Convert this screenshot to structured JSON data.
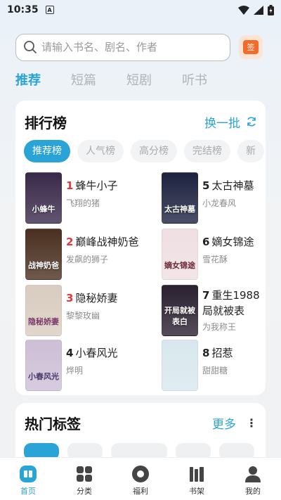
{
  "status": {
    "time": "10:35",
    "a_badge": "A"
  },
  "search": {
    "placeholder": "请输入书名、剧名、作者",
    "checkin_label": "签"
  },
  "top_tabs": [
    "推荐",
    "短篇",
    "短剧",
    "听书"
  ],
  "ranking": {
    "title": "排行榜",
    "refresh_label": "换一批",
    "chips": [
      "推荐榜",
      "人气榜",
      "高分榜",
      "完结榜",
      "新"
    ],
    "items": [
      {
        "rank": "1",
        "title": "蜂牛小子",
        "author": "飞翔的猪",
        "cover_text": "小蜂牛",
        "cover_color": "#3a2a4a"
      },
      {
        "rank": "2",
        "title": "巅峰战神奶爸",
        "author": "发飙的狮子",
        "cover_text": "战神奶爸",
        "cover_color": "#4a3020"
      },
      {
        "rank": "3",
        "title": "隐秘娇妻",
        "author": "黎黎玫幽",
        "cover_text": "隐秘娇妻",
        "cover_color": "#d9ccc0"
      },
      {
        "rank": "4",
        "title": "小春风光",
        "author": "烨明",
        "cover_text": "小春风光",
        "cover_color": "#cdbfd6"
      },
      {
        "rank": "5",
        "title": "太古神墓",
        "author": "小龙春风",
        "cover_text": "太古神墓",
        "cover_color": "#1d2240"
      },
      {
        "rank": "6",
        "title": "嫡女锦途",
        "author": "雪花酥",
        "cover_text": "嫡女锦途",
        "cover_color": "#efdfe2"
      },
      {
        "rank": "7",
        "title": "重生1988局就被表",
        "author": "为我称王",
        "cover_text": "开局就被表白",
        "cover_color": "#2a2030"
      },
      {
        "rank": "8",
        "title": "招惹",
        "author": "甜甜糖",
        "cover_text": "",
        "cover_color": "#d8e8ee"
      }
    ]
  },
  "tags": {
    "title": "热门标签",
    "more_label": "更多",
    "more_icon": "⋮"
  },
  "nav": [
    "首页",
    "分类",
    "福利",
    "书架",
    "我的"
  ],
  "colors": {
    "accent": "#2aa3d6",
    "rank_top": "#e0383b",
    "checkin": "#f26b2a"
  }
}
